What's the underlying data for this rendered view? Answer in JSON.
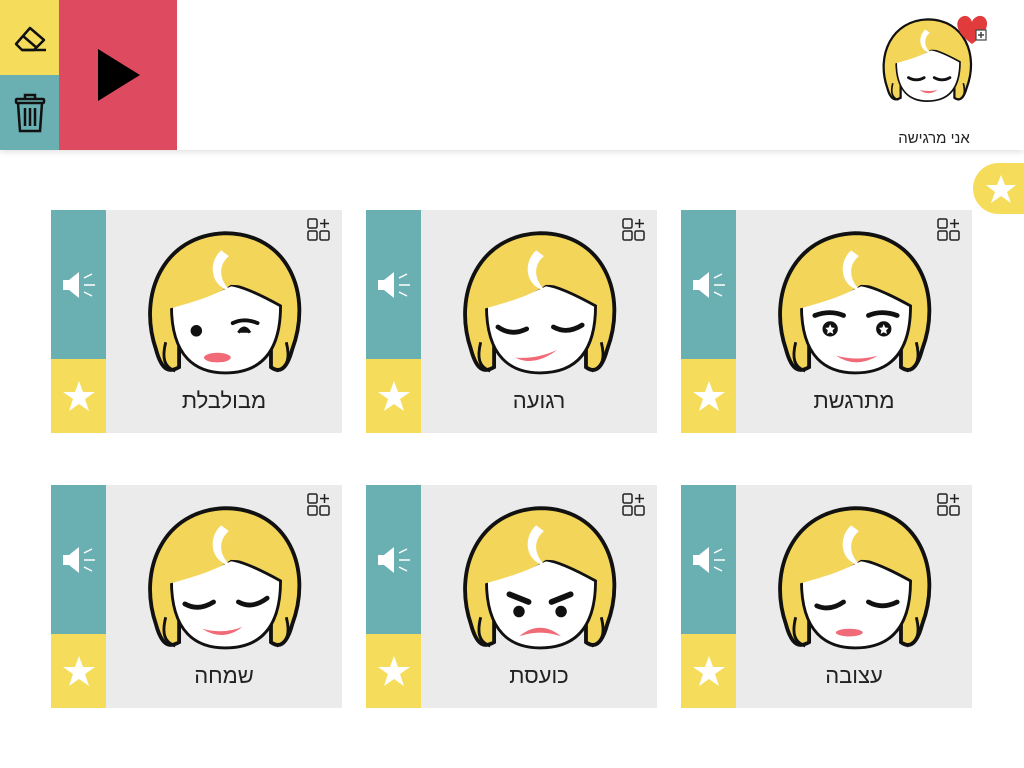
{
  "toolbar": {
    "erase_icon": "eraser-icon",
    "trash_icon": "trash-icon",
    "play_icon": "play-icon"
  },
  "sentence": {
    "label": "אני מרגישה",
    "icon": "heart-plus-icon"
  },
  "favorites_tab": {
    "icon": "star-icon"
  },
  "cards": [
    {
      "label": "מתרגשת",
      "expression": "excited"
    },
    {
      "label": "רגועה",
      "expression": "calm"
    },
    {
      "label": "מבולבלת",
      "expression": "confused"
    },
    {
      "label": "עצובה",
      "expression": "sad"
    },
    {
      "label": "כועסת",
      "expression": "angry"
    },
    {
      "label": "שמחה",
      "expression": "happy"
    }
  ],
  "colors": {
    "yellow": "#f5dd5b",
    "teal": "#6aafb2",
    "red": "#de4b61",
    "card_bg": "#ebebeb",
    "hair": "#f3d55a",
    "lips": "#f06a78"
  }
}
